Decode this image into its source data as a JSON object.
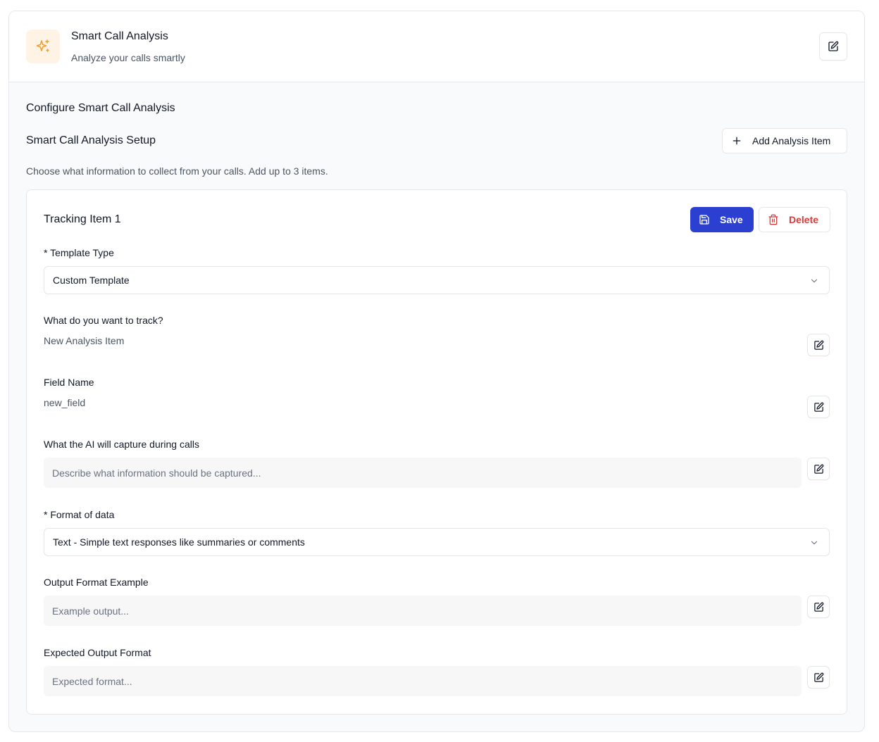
{
  "header": {
    "title": "Smart Call Analysis",
    "subtitle": "Analyze your calls smartly",
    "icon": "sparkles-icon",
    "icon_color": "#f0a030",
    "icon_bg": "#fff3e6"
  },
  "config": {
    "title": "Configure Smart Call Analysis",
    "setup_title": "Smart Call Analysis Setup",
    "add_button": "Add Analysis Item",
    "description": "Choose what information to collect from your calls. Add up to 3 items."
  },
  "item": {
    "title": "Tracking Item 1",
    "save_label": "Save",
    "delete_label": "Delete",
    "template_type": {
      "label": "* Template Type",
      "value": "Custom Template"
    },
    "track": {
      "label": "What do you want to track?",
      "value": "New Analysis Item"
    },
    "field_name": {
      "label": "Field Name",
      "value": "new_field"
    },
    "capture": {
      "label": "What the AI will capture during calls",
      "placeholder": "Describe what information should be captured..."
    },
    "format": {
      "label": "* Format of data",
      "value": "Text - Simple text responses like summaries or comments"
    },
    "output_example": {
      "label": "Output Format Example",
      "placeholder": "Example output..."
    },
    "expected_format": {
      "label": "Expected Output Format",
      "placeholder": "Expected format..."
    }
  },
  "colors": {
    "primary": "#2b3fd1",
    "danger": "#dc3b3b"
  }
}
